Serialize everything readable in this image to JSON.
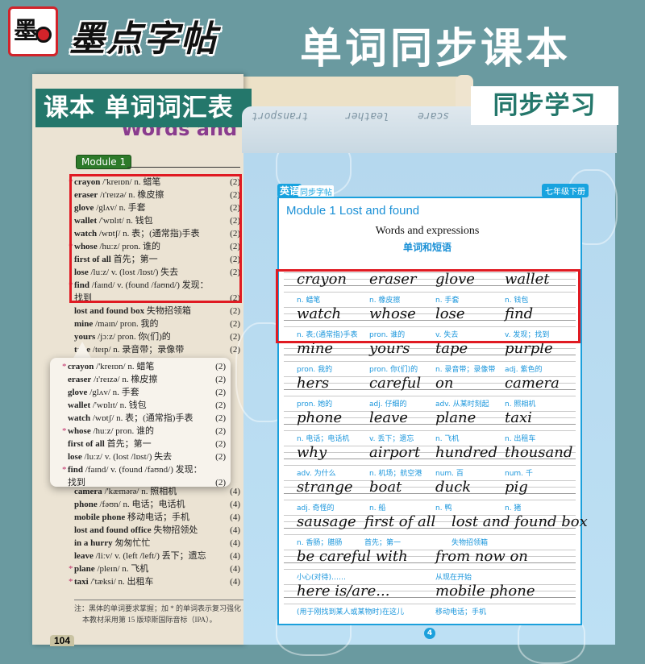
{
  "brand": {
    "logo_mark": "墨",
    "name": "墨点字帖"
  },
  "main_title": "单词同步课本",
  "left_tag": "课本  单词词汇表",
  "right_tag": "同步学习",
  "textbook": {
    "section_title": "Words and",
    "module": "Module 1",
    "entries": [
      {
        "star": true,
        "word": "crayon",
        "rest": " /'kreɪɒn/ n. 蜡笔",
        "unit": "(2)"
      },
      {
        "star": false,
        "word": "eraser",
        "rest": " /ɪ'reɪzə/ n. 橡皮擦",
        "unit": "(2)"
      },
      {
        "star": false,
        "word": "glove",
        "rest": " /glʌv/ n. 手套",
        "unit": "(2)"
      },
      {
        "star": false,
        "word": "wallet",
        "rest": " /'wɒlɪt/ n. 钱包",
        "unit": "(2)"
      },
      {
        "star": false,
        "word": "watch",
        "rest": " /wɒtʃ/ n. 表；(通常指)手表",
        "unit": "(2)"
      },
      {
        "star": true,
        "word": "whose",
        "rest": " /huːz/ pron. 谁的",
        "unit": "(2)"
      },
      {
        "star": false,
        "word": "first of all",
        "rest": " 首先；第一",
        "unit": "(2)"
      },
      {
        "star": false,
        "word": "lose",
        "rest": " /luːz/ v. (lost /lɒst/) 失去",
        "unit": "(2)"
      },
      {
        "star": true,
        "word": "find",
        "rest": " /faɪnd/ v. (found /faʊnd/) 发现：",
        "unit": ""
      },
      {
        "star": false,
        "word": "",
        "rest": "      找到",
        "unit": "(2)"
      },
      {
        "star": false,
        "word": "lost and found box",
        "rest": " 失物招领箱",
        "unit": "(2)"
      },
      {
        "star": false,
        "word": "mine",
        "rest": " /maɪn/ pron. 我的",
        "unit": "(2)"
      },
      {
        "star": false,
        "word": "yours",
        "rest": " /jɔːz/ pron. 你(们)的",
        "unit": "(2)"
      },
      {
        "star": false,
        "word": "tape",
        "rest": " /teɪp/ n. 录音带；录像带",
        "unit": "(2)"
      }
    ],
    "entries_lower": [
      {
        "star": false,
        "word": "camera",
        "rest": " /'kæmərə/ n. 照相机",
        "unit": "(4)"
      },
      {
        "star": false,
        "word": "phone",
        "rest": " /fəʊn/ n. 电话；电话机",
        "unit": "(4)"
      },
      {
        "star": false,
        "word": "  mobile phone",
        "rest": " 移动电话；手机",
        "unit": "(4)"
      },
      {
        "star": false,
        "word": "lost and found office",
        "rest": " 失物招领处",
        "unit": "(4)"
      },
      {
        "star": false,
        "word": "in a hurry",
        "rest": " 匆匆忙忙",
        "unit": "(4)"
      },
      {
        "star": false,
        "word": "leave",
        "rest": " /liːv/ v. (left /left/) 丢下；遗忘",
        "unit": "(4)"
      },
      {
        "star": true,
        "word": "plane",
        "rest": " /pleɪn/ n. 飞机",
        "unit": "(4)"
      },
      {
        "star": true,
        "word": "taxi",
        "rest": " /'tæksi/ n. 出租车",
        "unit": "(4)"
      }
    ],
    "footnote_1": "注：黑体的单词要求掌握；加 * 的单词表示复习强化",
    "footnote_2": "本教材采用第 15 版琼斯国际音标（IPA）。",
    "page_number": "104"
  },
  "workbook": {
    "cover_words": [
      "transport",
      "leather",
      "scare"
    ],
    "header_subject": "英语",
    "header_series": "同步字帖",
    "grade": "七年级下册",
    "module_title": "Module 1    Lost and found",
    "section_en": "Words and expressions",
    "section_zh": "单词和短语",
    "rows": [
      [
        {
          "w": "crayon",
          "g": "n. 蜡笔"
        },
        {
          "w": "eraser",
          "g": "n. 橡皮擦"
        },
        {
          "w": "glove",
          "g": "n. 手套"
        },
        {
          "w": "wallet",
          "g": "n. 钱包"
        }
      ],
      [
        {
          "w": "watch",
          "g": "n. 表;(通常指)手表"
        },
        {
          "w": "whose",
          "g": "pron. 谁的"
        },
        {
          "w": "lose",
          "g": "v. 失去"
        },
        {
          "w": "find",
          "g": "v. 发现；找到"
        }
      ],
      [
        {
          "w": "mine",
          "g": "pron. 我的"
        },
        {
          "w": "yours",
          "g": "pron. 你(们)的"
        },
        {
          "w": "tape",
          "g": "n. 录音带；录像带"
        },
        {
          "w": "purple",
          "g": "adj. 紫色的"
        }
      ],
      [
        {
          "w": "hers",
          "g": "pron. 她的"
        },
        {
          "w": "careful",
          "g": "adj. 仔细的"
        },
        {
          "w": "on",
          "g": "adv. 从某时刻起"
        },
        {
          "w": "camera",
          "g": "n. 照相机"
        }
      ],
      [
        {
          "w": "phone",
          "g": "n. 电话；电话机"
        },
        {
          "w": "leave",
          "g": "v. 丢下；遗忘"
        },
        {
          "w": "plane",
          "g": "n. 飞机"
        },
        {
          "w": "taxi",
          "g": "n. 出租车"
        }
      ],
      [
        {
          "w": "why",
          "g": "adv. 为什么"
        },
        {
          "w": "airport",
          "g": "n. 机场；航空港"
        },
        {
          "w": "hundred",
          "g": "num. 百"
        },
        {
          "w": "thousand",
          "g": "num. 千"
        }
      ],
      [
        {
          "w": "strange",
          "g": "adj. 奇怪的"
        },
        {
          "w": "boat",
          "g": "n. 船"
        },
        {
          "w": "duck",
          "g": "n. 鸭"
        },
        {
          "w": "pig",
          "g": "n. 猪"
        }
      ]
    ],
    "phrase_rows": [
      [
        {
          "w": "sausage",
          "g": "n. 香肠；腊肠"
        },
        {
          "w": "first of all",
          "g": "首先；第一"
        },
        {
          "w": "lost and found box",
          "g": "失物招领箱"
        }
      ],
      [
        {
          "w": "be careful with",
          "g": "小心(对待)……"
        },
        {
          "w": "from now on",
          "g": "从现在开始"
        }
      ],
      [
        {
          "w": "here is/are...",
          "g": "(用于刚找到某人或某物时)在这儿"
        },
        {
          "w": "mobile phone",
          "g": "移动电话；手机"
        }
      ]
    ],
    "page_number": "4"
  }
}
